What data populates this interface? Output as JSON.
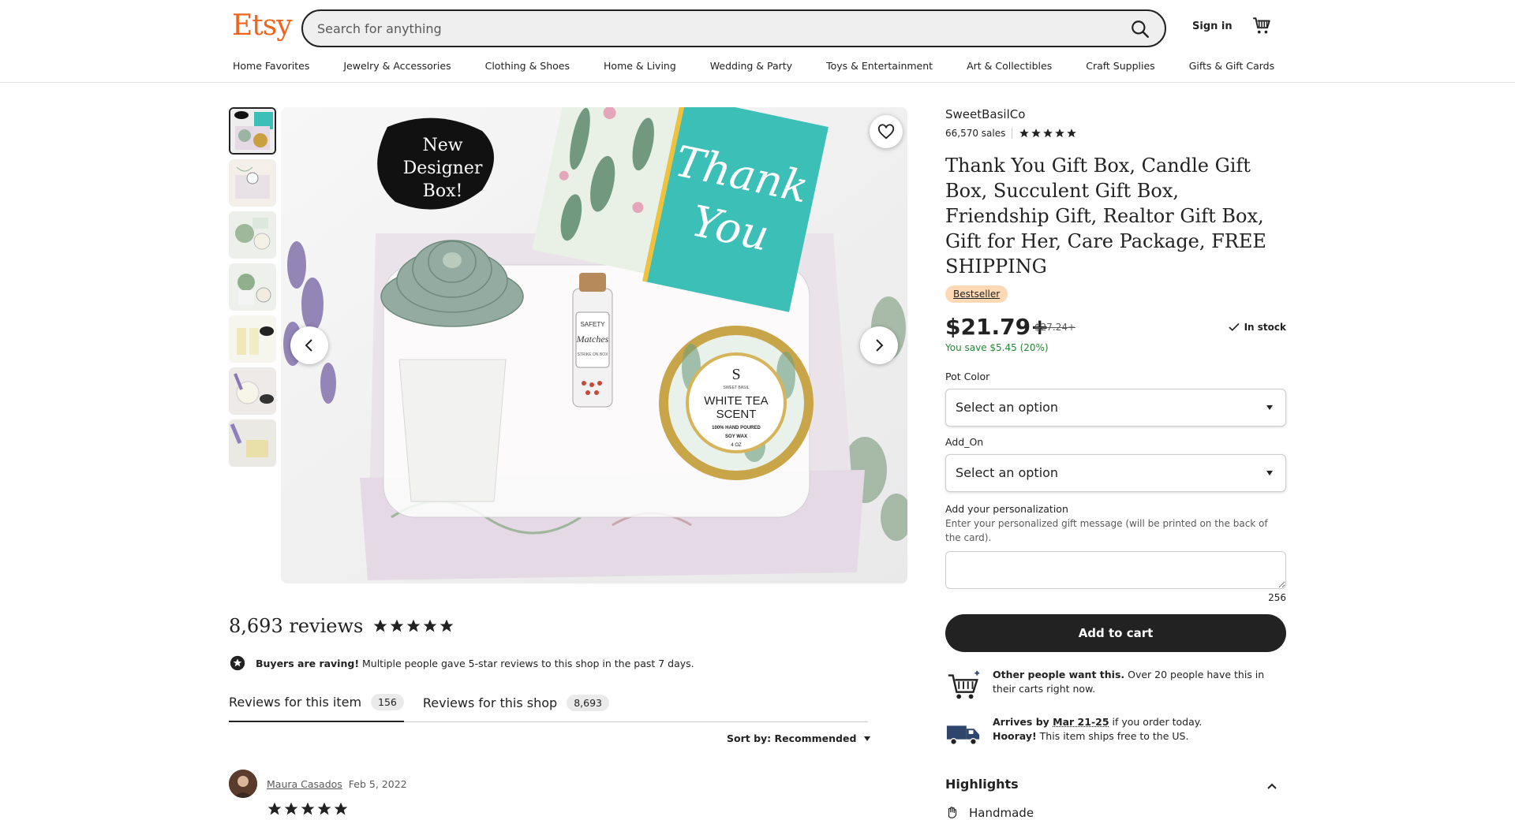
{
  "header": {
    "logo": "Etsy",
    "search_placeholder": "Search for anything",
    "signin": "Sign in",
    "nav": [
      "Home Favorites",
      "Jewelry & Accessories",
      "Clothing & Shoes",
      "Home & Living",
      "Wedding & Party",
      "Toys & Entertainment",
      "Art & Collectibles",
      "Craft Supplies",
      "Gifts & Gift Cards"
    ]
  },
  "gallery": {
    "badge_text": [
      "New",
      "Designer",
      "Box!"
    ],
    "card_text": [
      "Thank",
      "You"
    ],
    "candle_label": [
      "SWEET BASIL",
      "WHITE TEA",
      "SCENT",
      "100% HAND POURED",
      "SOY WAX",
      "4 OZ"
    ],
    "matches_label": [
      "SAFETY",
      "Matches",
      "STRIKE ON BOX"
    ]
  },
  "product": {
    "shop": "SweetBasilCo",
    "sales": "66,570 sales",
    "title": "Thank You Gift Box, Candle Gift Box, Succulent Gift Box, Friendship Gift, Realtor Gift Box, Gift for Her, Care Package, FREE SHIPPING",
    "badge": "Bestseller",
    "price": "$21.79+",
    "original_price": "$27.24+",
    "stock": "In stock",
    "savings": "You save $5.45 (20%)",
    "pot_color_label": "Pot Color",
    "pot_color_value": "Select an option",
    "addon_label": "Add_On",
    "addon_value": "Select an option",
    "personalization_label": "Add your personalization",
    "personalization_hint": "Enter your personalized gift message (will be printed on the back of the card).",
    "char_count": "256",
    "add_to_cart": "Add to cart",
    "demand_bold": "Other people want this.",
    "demand_text": " Over 20 people have this in their carts right now.",
    "arrives_bold": "Arrives by ",
    "arrives_date": "Mar 21-25",
    "arrives_text": " if you order today.",
    "hooray_bold": "Hooray!",
    "hooray_text": " This item ships free to the US.",
    "highlights": "Highlights",
    "handmade": "Handmade"
  },
  "reviews": {
    "count": "8,693 reviews",
    "raving_bold": "Buyers are raving!",
    "raving_text": " Multiple people gave 5-star reviews to this shop in the past 7 days.",
    "tab_item": "Reviews for this item",
    "tab_item_count": "156",
    "tab_shop": "Reviews for this shop",
    "tab_shop_count": "8,693",
    "sort": "Sort by: Recommended",
    "reviewer": "Maura Casados",
    "date": "Feb 5, 2022"
  },
  "colors": {
    "brand": "#f1641e",
    "savings": "#258635",
    "bestseller_bg": "#fdd9b5",
    "teal_card": "#3bbfb6"
  }
}
